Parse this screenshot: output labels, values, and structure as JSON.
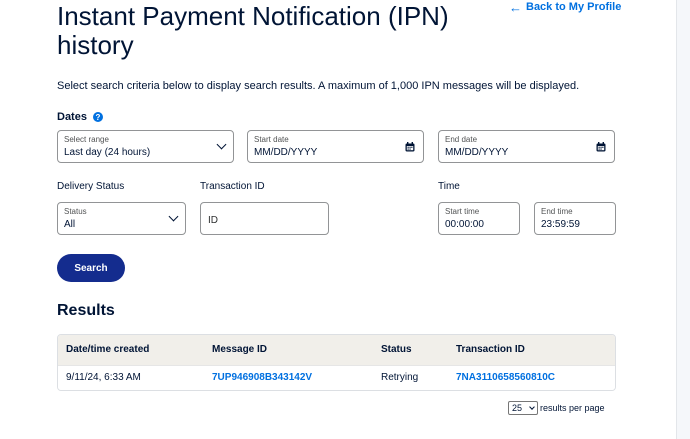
{
  "header": {
    "title": "Instant Payment Notification (IPN) history",
    "back_link": "Back to My Profile"
  },
  "intro": "Select search criteria below to display search results. A maximum of 1,000 IPN messages will be displayed.",
  "filters": {
    "dates_label": "Dates",
    "range": {
      "label": "Select range",
      "value": "Last day (24 hours)"
    },
    "start_date": {
      "label": "Start date",
      "value": "MM/DD/YYYY"
    },
    "end_date": {
      "label": "End date",
      "value": "MM/DD/YYYY"
    },
    "delivery_status_label": "Delivery Status",
    "status": {
      "label": "Status",
      "value": "All"
    },
    "transaction_id_label": "Transaction ID",
    "transaction_id_placeholder": "ID",
    "time_label": "Time",
    "start_time": {
      "label": "Start time",
      "value": "00:00:00"
    },
    "end_time": {
      "label": "End time",
      "value": "23:59:59"
    },
    "search_button": "Search"
  },
  "results": {
    "title": "Results",
    "columns": [
      "Date/time created",
      "Message ID",
      "Status",
      "Transaction ID"
    ],
    "rows": [
      {
        "date": "9/11/24, 6:33 AM",
        "message_id": "7UP946908B343142V",
        "status": "Retrying",
        "transaction_id": "7NA3110658560810C"
      }
    ],
    "per_page_value": "25",
    "per_page_label": "results per page"
  },
  "colors": {
    "primary_button": "#142c8e",
    "link": "#0070e0",
    "header_row": "#f1efea"
  }
}
